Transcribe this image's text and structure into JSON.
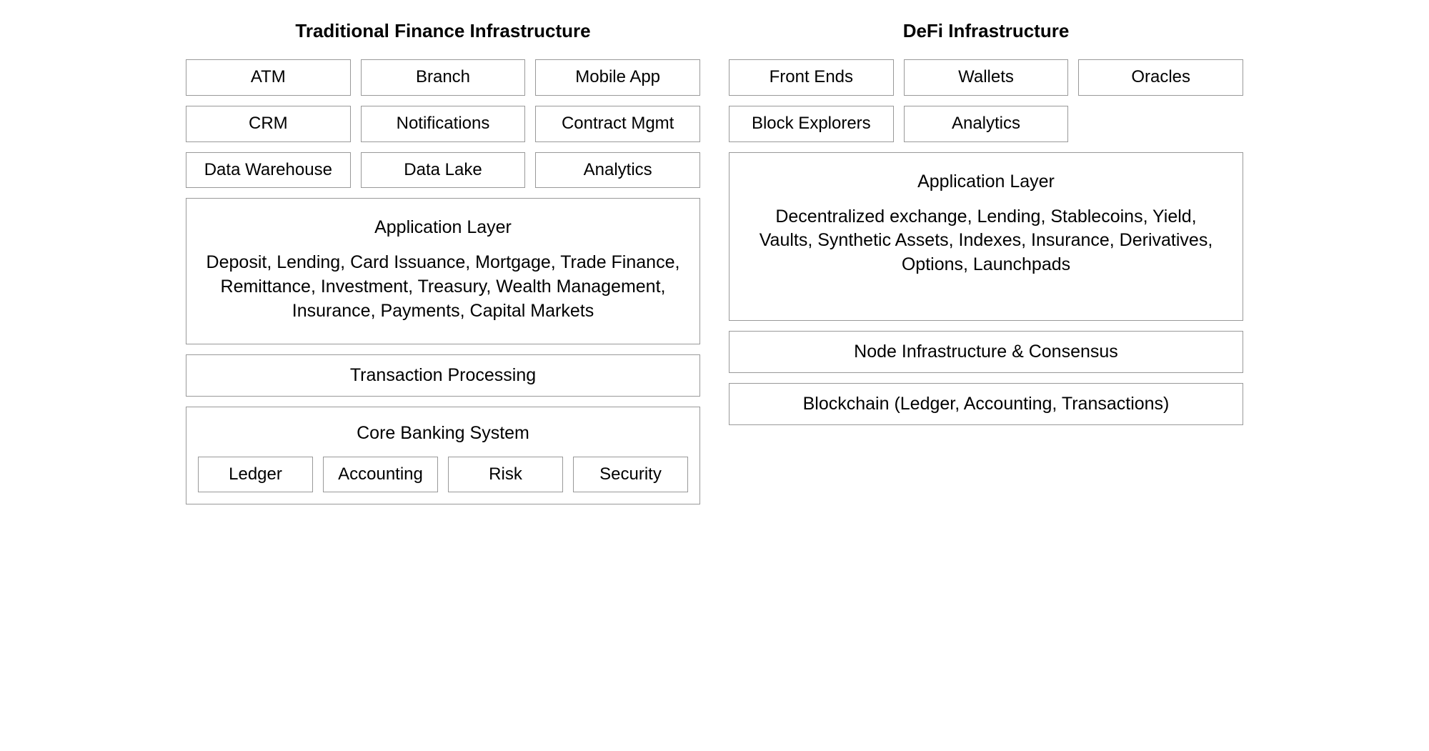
{
  "left": {
    "title": "Traditional Finance Infrastructure",
    "rows": [
      [
        "ATM",
        "Branch",
        "Mobile App"
      ],
      [
        "CRM",
        "Notifications",
        "Contract Mgmt"
      ],
      [
        "Data Warehouse",
        "Data Lake",
        "Analytics"
      ]
    ],
    "app_layer": {
      "title": "Application Layer",
      "body": "Deposit, Lending, Card Issuance, Mortgage, Trade Finance, Remittance, Investment, Treasury, Wealth Management, Insurance, Payments, Capital Markets"
    },
    "tx": "Transaction Processing",
    "core": {
      "title": "Core Banking System",
      "items": [
        "Ledger",
        "Accounting",
        "Risk",
        "Security"
      ]
    }
  },
  "right": {
    "title": "DeFi Infrastructure",
    "rows": [
      [
        "Front Ends",
        "Wallets",
        "Oracles"
      ],
      [
        "Block Explorers",
        "Analytics",
        ""
      ]
    ],
    "app_layer": {
      "title": "Application Layer",
      "body": "Decentralized exchange, Lending, Stablecoins, Yield, Vaults, Synthetic Assets, Indexes, Insurance, Derivatives, Options, Launchpads"
    },
    "node": "Node Infrastructure & Consensus",
    "blockchain": "Blockchain (Ledger, Accounting, Transactions)"
  }
}
